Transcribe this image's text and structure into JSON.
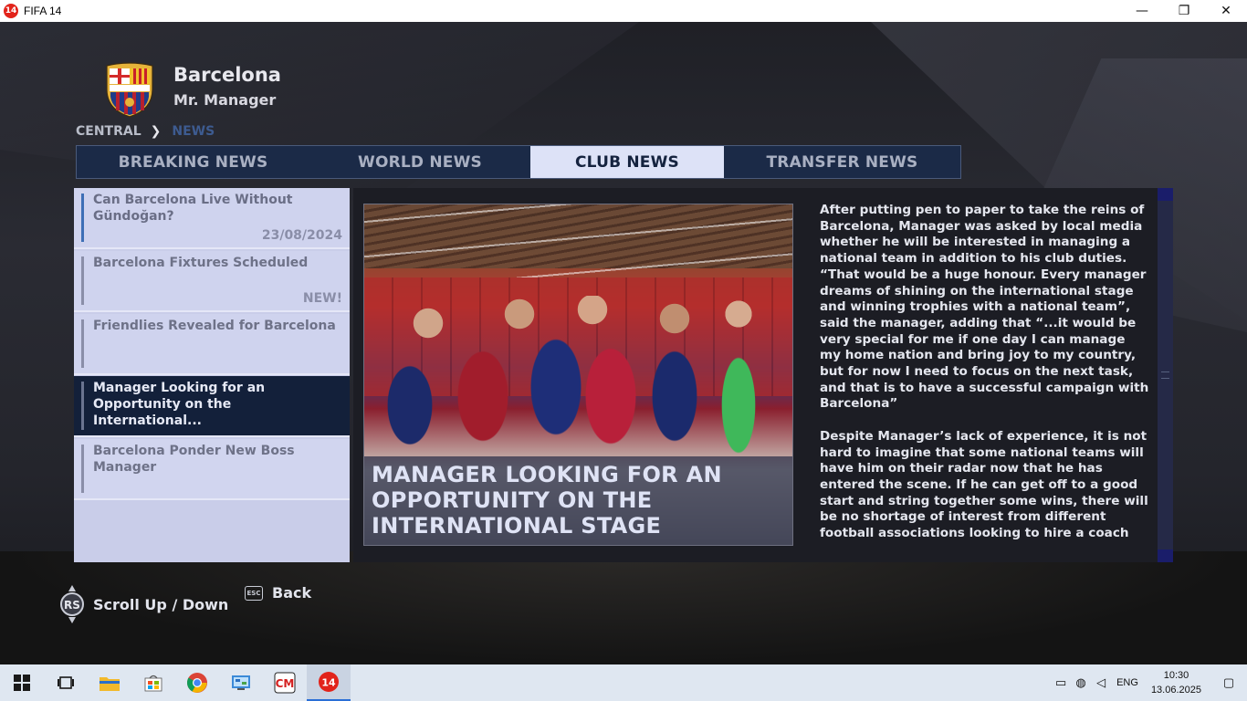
{
  "window": {
    "title": "FIFA 14",
    "minimize": "—",
    "maximize": "❐",
    "close": "✕",
    "app_icon_text": "14"
  },
  "header": {
    "club_name": "Barcelona",
    "manager_name": "Mr. Manager"
  },
  "breadcrumb": {
    "root": "CENTRAL",
    "separator": "❯",
    "current": "NEWS"
  },
  "tabs": [
    {
      "label": "BREAKING NEWS",
      "active": false
    },
    {
      "label": "WORLD NEWS",
      "active": false
    },
    {
      "label": "CLUB NEWS",
      "active": true
    },
    {
      "label": "TRANSFER NEWS",
      "active": false
    }
  ],
  "news_list": [
    {
      "headline": "Can Barcelona Live Without Gündoğan?",
      "meta": "23/08/2024"
    },
    {
      "headline": "Barcelona Fixtures Scheduled",
      "meta": "NEW!"
    },
    {
      "headline": "Friendlies Revealed for Barcelona",
      "meta": ""
    },
    {
      "headline": "Manager Looking for an Opportunity on the International...",
      "meta": "",
      "selected": true
    },
    {
      "headline": "Barcelona Ponder New Boss Manager",
      "meta": ""
    }
  ],
  "article": {
    "image_caption_lines": [
      "MANAGER LOOKING FOR AN",
      "OPPORTUNITY ON THE",
      "INTERNATIONAL STAGE"
    ],
    "paragraphs": [
      "After putting pen to paper to take the reins of Barcelona, Manager was asked by local media whether he will be interested in managing a national team in addition to his club duties. “That would be a huge honour. Every manager dreams of shining on the international stage and winning trophies with a national team”, said the manager, adding that “...it would be very special for me if one day I can manage my home nation and bring joy to my country, but for now I need to focus on the next task, and that is to have a successful campaign with Barcelona”",
      "Despite Manager’s lack of experience, it is not hard to imagine that some national teams will have him on their radar now that he has entered the scene. If he can get off to a good start and string together some wins, there will be no shortage of interest from different football associations looking to hire a coach"
    ]
  },
  "controls": [
    {
      "icon": "rs-stick-icon",
      "label": "Scroll Up / Down"
    },
    {
      "icon": "esc-key-icon",
      "key_text": "ESC",
      "label": "Back"
    }
  ],
  "taskbar": {
    "language": "ENG",
    "time": "10:30",
    "date": "13.06.2025",
    "fifa_icon_text": "14"
  }
}
